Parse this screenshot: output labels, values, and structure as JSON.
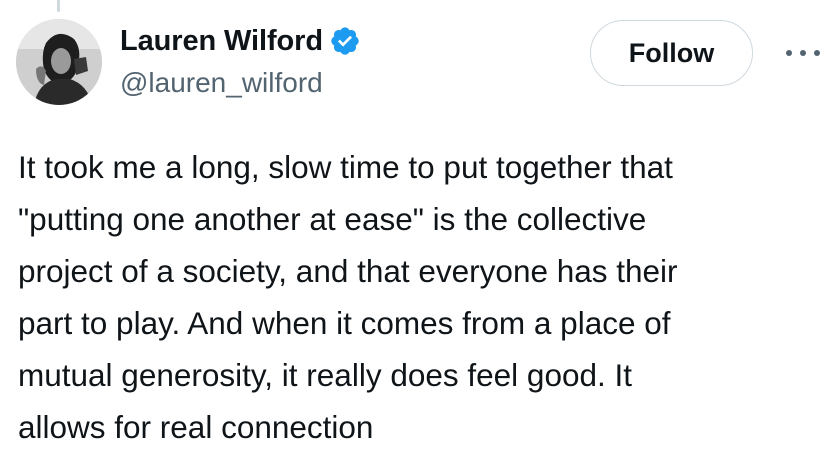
{
  "author": {
    "display_name": "Lauren Wilford",
    "handle": "@lauren_wilford",
    "verified": true,
    "verified_color": "#1d9bf0"
  },
  "actions": {
    "follow_label": "Follow",
    "more_icon": "more-horizontal-icon"
  },
  "tweet": {
    "lines": [
      "It took me a long, slow time to put together that",
      "\"putting one another at ease\" is the collective",
      "project of a society, and that everyone has their",
      "part to play. And when it comes from a place of",
      "mutual generosity, it really does feel good. It",
      "allows for real connection"
    ]
  },
  "colors": {
    "text_primary": "#0f1419",
    "text_secondary": "#536471",
    "border": "#cfd9de"
  }
}
